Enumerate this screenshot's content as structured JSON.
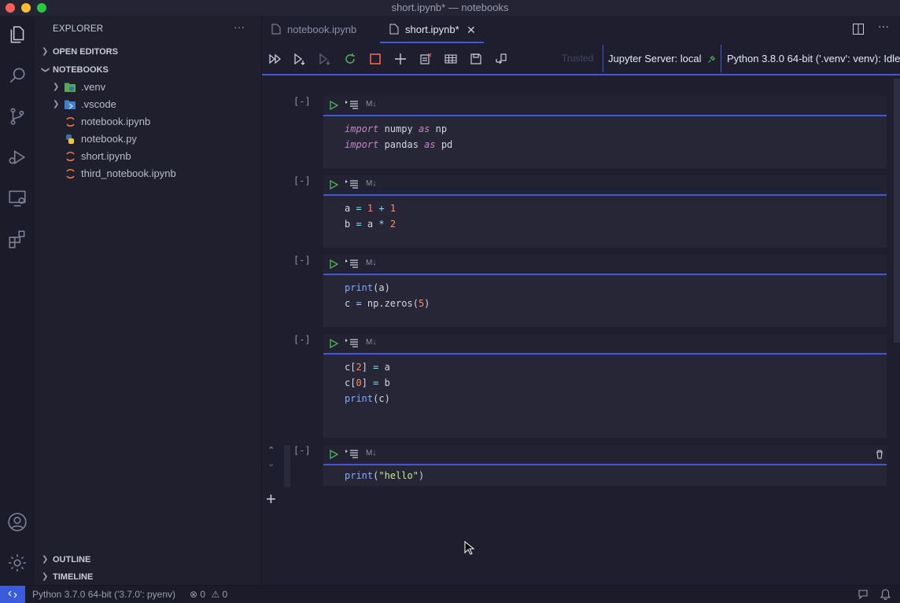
{
  "window": {
    "title": "short.ipynb* — notebooks",
    "traffic_lights": [
      "#ff5f57",
      "#febc2e",
      "#28c840"
    ]
  },
  "activity_bar": {
    "icons": [
      "files-icon",
      "search-icon",
      "source-control-icon",
      "run-debug-icon",
      "remote-explorer-icon",
      "extensions-icon",
      "account-icon",
      "settings-gear-icon"
    ]
  },
  "sidebar": {
    "header": "EXPLORER",
    "more_actions": "···",
    "open_editors": "OPEN EDITORS",
    "folder": "NOTEBOOKS",
    "items": [
      {
        "label": ".venv",
        "type": "folder",
        "icon": "python-folder-icon"
      },
      {
        "label": ".vscode",
        "type": "folder",
        "icon": "vscode-folder-icon"
      },
      {
        "label": "notebook.ipynb",
        "type": "file",
        "icon": "jupyter-icon"
      },
      {
        "label": "notebook.py",
        "type": "file",
        "icon": "python-icon"
      },
      {
        "label": "short.ipynb",
        "type": "file",
        "icon": "jupyter-icon"
      },
      {
        "label": "third_notebook.ipynb",
        "type": "file",
        "icon": "jupyter-icon"
      }
    ],
    "outline": "OUTLINE",
    "timeline": "TIMELINE"
  },
  "tabs": [
    {
      "label": "notebook.ipynb",
      "active": false
    },
    {
      "label": "short.ipynb*",
      "active": true
    }
  ],
  "toolbar": {
    "trusted": "Trusted",
    "server": "Jupyter Server: local",
    "kernel": "Python 3.8.0 64-bit ('.venv': venv): Idle"
  },
  "cells": [
    {
      "count": "[-]",
      "md_label": "M↓"
    },
    {
      "count": "[-]",
      "md_label": "M↓"
    },
    {
      "count": "[-]",
      "md_label": "M↓"
    },
    {
      "count": "[-]",
      "md_label": "M↓"
    },
    {
      "count": "[-]",
      "md_label": "M↓"
    }
  ],
  "code": {
    "c1l1": [
      "import",
      " numpy ",
      "as",
      " np"
    ],
    "c1l2": [
      "import",
      " pandas ",
      "as",
      " pd"
    ],
    "c2l1": [
      "a ",
      "=",
      " ",
      "1",
      " ",
      "+",
      " ",
      "1"
    ],
    "c2l2": [
      "b ",
      "=",
      " a ",
      "*",
      " ",
      "2"
    ],
    "c3l1": [
      "print",
      "(a)"
    ],
    "c3l2": [
      "c ",
      "=",
      " np.zeros(",
      "5",
      ")"
    ],
    "c4l1": [
      "c[",
      "2",
      "] ",
      "=",
      " a"
    ],
    "c4l2": [
      "c[",
      "0",
      "] ",
      "=",
      " b"
    ],
    "c4l3": [
      "print",
      "(c)"
    ],
    "c5l1": [
      "print",
      "(",
      "\"hello\"",
      ")"
    ]
  },
  "statusbar": {
    "interpreter": "Python 3.7.0 64-bit ('3.7.0': pyenv)",
    "errors": "0",
    "warnings": "0"
  },
  "colors": {
    "accent": "#3b5bdb",
    "background": "#1e1e2e",
    "remote_button": "#3b5bdb"
  }
}
